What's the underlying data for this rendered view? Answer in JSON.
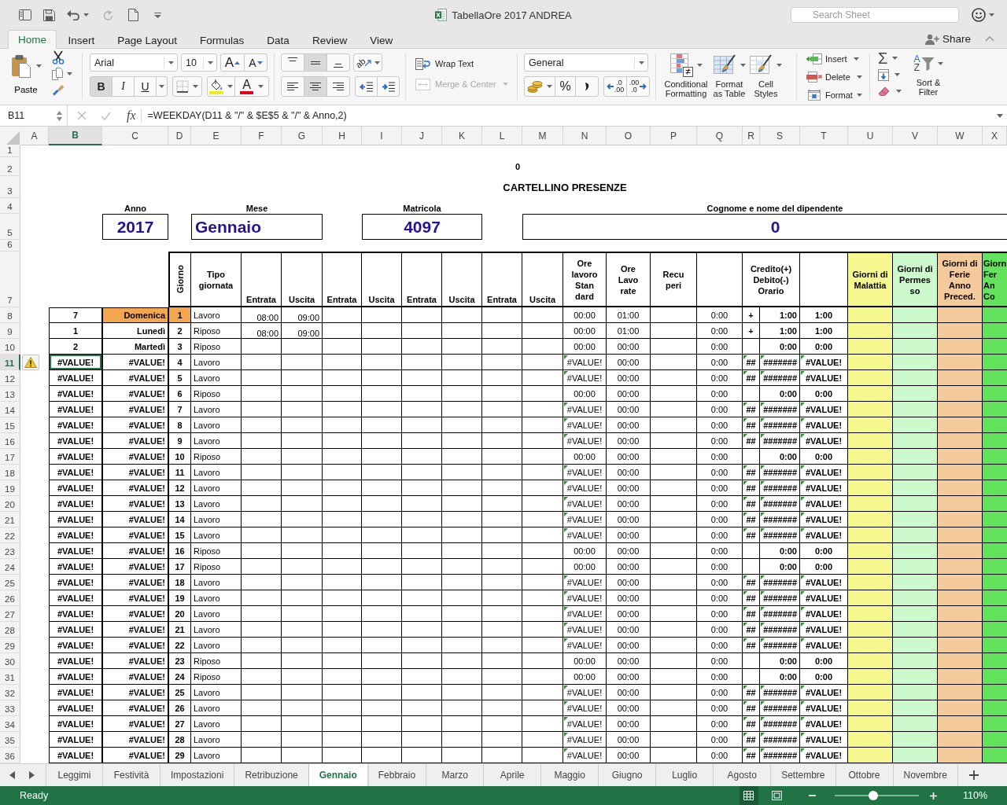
{
  "window": {
    "title": "TabellaOre 2017 ANDREA",
    "search": {
      "placeholder": "Search Sheet"
    }
  },
  "ribbon_tabs": [
    {
      "label": "Home",
      "selected": true
    },
    {
      "label": "Insert",
      "selected": false
    },
    {
      "label": "Page Layout",
      "selected": false
    },
    {
      "label": "Formulas",
      "selected": false
    },
    {
      "label": "Data",
      "selected": false
    },
    {
      "label": "Review",
      "selected": false
    },
    {
      "label": "View",
      "selected": false
    }
  ],
  "share": {
    "label": "Share"
  },
  "ribbon": {
    "paste": "Paste",
    "font_name": "Arial",
    "font_size": "10",
    "grow_font": "A",
    "shrink_font": "A",
    "font_styles": [
      {
        "label": "B",
        "selected": true
      },
      {
        "label": "I",
        "selected": false
      },
      {
        "label": "U",
        "selected": false
      }
    ],
    "font_color": "A",
    "alignment": {
      "vertical": [
        {
          "selected": false
        },
        {
          "selected": true
        },
        {
          "selected": false
        }
      ],
      "horizontal": [
        {
          "selected": false
        },
        {
          "selected": true
        },
        {
          "selected": false
        }
      ]
    },
    "orientation": "ab",
    "wrap_text": "Wrap Text",
    "merge_center": {
      "label": "Merge & Center",
      "disabled": true
    },
    "number_format": "General",
    "percent": "%",
    "increase_decimal": [
      ".0",
      ".00"
    ],
    "decrease_decimal": [
      ".00",
      ".0"
    ],
    "conditional_formatting": "Conditional Formatting",
    "format_as_table": "Format as Table",
    "cell_styles": "Cell Styles",
    "insert": "Insert",
    "delete": "Delete",
    "format": "Format",
    "autosum": "Σ",
    "sort_letters": [
      "A",
      "Z"
    ],
    "sort_filter": "Sort & Filter"
  },
  "formula_bar": {
    "cell_reference": "B11",
    "function_label": "fx",
    "formula": "=WEEKDAY(D11 & \"/\" & $E$5 & \"/\" & Anno,2)"
  },
  "sheet": {
    "columns": [
      {
        "label": "A",
        "selected": false
      },
      {
        "label": "B",
        "selected": true
      },
      {
        "label": "C",
        "selected": false
      },
      {
        "label": "D",
        "selected": false
      },
      {
        "label": "E",
        "selected": false
      },
      {
        "label": "F",
        "selected": false
      },
      {
        "label": "G",
        "selected": false
      },
      {
        "label": "H",
        "selected": false
      },
      {
        "label": "I",
        "selected": false
      },
      {
        "label": "J",
        "selected": false
      },
      {
        "label": "K",
        "selected": false
      },
      {
        "label": "L",
        "selected": false
      },
      {
        "label": "M",
        "selected": false
      },
      {
        "label": "N",
        "selected": false
      },
      {
        "label": "O",
        "selected": false
      },
      {
        "label": "P",
        "selected": false
      },
      {
        "label": "Q",
        "selected": false
      },
      {
        "label": "R",
        "selected": false
      },
      {
        "label": "S",
        "selected": false
      },
      {
        "label": "T",
        "selected": false
      },
      {
        "label": "U",
        "selected": false
      },
      {
        "label": "V",
        "selected": false
      },
      {
        "label": "W",
        "selected": false
      },
      {
        "label": "X",
        "selected": false
      }
    ],
    "row_numbers": [
      {
        "label": "1",
        "selected": false
      },
      {
        "label": "2",
        "selected": false
      },
      {
        "label": "3",
        "selected": false
      },
      {
        "label": "4",
        "selected": false
      },
      {
        "label": "5",
        "selected": false
      },
      {
        "label": "6",
        "selected": false
      },
      {
        "label": "7",
        "selected": false
      },
      {
        "label": "8",
        "selected": false
      },
      {
        "label": "9",
        "selected": false
      },
      {
        "label": "10",
        "selected": false
      },
      {
        "label": "11",
        "selected": true
      },
      {
        "label": "12",
        "selected": false
      },
      {
        "label": "13",
        "selected": false
      },
      {
        "label": "14",
        "selected": false
      },
      {
        "label": "15",
        "selected": false
      },
      {
        "label": "16",
        "selected": false
      },
      {
        "label": "17",
        "selected": false
      },
      {
        "label": "18",
        "selected": false
      },
      {
        "label": "19",
        "selected": false
      },
      {
        "label": "20",
        "selected": false
      },
      {
        "label": "21",
        "selected": false
      },
      {
        "label": "22",
        "selected": false
      },
      {
        "label": "23",
        "selected": false
      },
      {
        "label": "24",
        "selected": false
      },
      {
        "label": "25",
        "selected": false
      },
      {
        "label": "26",
        "selected": false
      },
      {
        "label": "27",
        "selected": false
      },
      {
        "label": "28",
        "selected": false
      },
      {
        "label": "29",
        "selected": false
      },
      {
        "label": "30",
        "selected": false
      },
      {
        "label": "31",
        "selected": false
      },
      {
        "label": "32",
        "selected": false
      },
      {
        "label": "33",
        "selected": false
      },
      {
        "label": "34",
        "selected": false
      },
      {
        "label": "35",
        "selected": false
      },
      {
        "label": "36",
        "selected": false
      }
    ],
    "top_value": "0",
    "title": "CARTELLINO PRESENZE",
    "fields": [
      {
        "label": "Anno",
        "value": "2017"
      },
      {
        "label": "Mese",
        "value": "Gennaio"
      },
      {
        "label": "Matricola",
        "value": "4097"
      },
      {
        "label": "Cognome e nome del dipendente",
        "value": "0"
      }
    ],
    "table_headers": [
      {
        "text": "Giorno"
      },
      {
        "text": "Tipo\ngiornata"
      },
      {
        "text": "Entrata"
      },
      {
        "text": "Uscita"
      },
      {
        "text": "Entrata"
      },
      {
        "text": "Uscita"
      },
      {
        "text": "Entrata"
      },
      {
        "text": "Uscita"
      },
      {
        "text": "Entrata"
      },
      {
        "text": "Uscita"
      },
      {
        "text": "Ore\nlavoro\nStan\ndard"
      },
      {
        "text": "Ore\nLavo\nrate"
      },
      {
        "text": "Recu\nperi"
      },
      {
        "text": "Credito(+)\nDebito(-)\nOrario"
      },
      {
        "text": "Giorni di\nMalattia",
        "color": "#f7f78f"
      },
      {
        "text": "Giorni di\nPermes\nso",
        "color": "#ccfacc"
      },
      {
        "text": "Giorni di\nFerie\nAnno\nPreced.",
        "color": "#f5ca9b"
      },
      {
        "text": "Giorn\nFer\nAn\nCo",
        "color": "#63e35c"
      }
    ],
    "rows": [
      {
        "cells": {
          "B": "7",
          "C": "Domenica",
          "D": "1",
          "E": "Lavoro",
          "F": "08:00",
          "G": "09:00",
          "N": "00:00",
          "O": "01:00",
          "Q": "0:00",
          "R": "+",
          "S": "1:00",
          "T": "1:00"
        },
        "highlighted": true,
        "error_flags": false
      },
      {
        "cells": {
          "B": "1",
          "C": "Lunedì",
          "D": "2",
          "E": "Riposo",
          "F": "08:00",
          "G": "09:00",
          "N": "00:00",
          "O": "01:00",
          "Q": "0:00",
          "R": "+",
          "S": "1:00",
          "T": "1:00"
        },
        "highlighted": false,
        "error_flags": false
      },
      {
        "cells": {
          "B": "2",
          "C": "Martedì",
          "D": "3",
          "E": "Riposo",
          "N": "00:00",
          "O": "00:00",
          "Q": "0:00",
          "S": "0:00",
          "T": "0:00"
        },
        "highlighted": false,
        "error_flags": false
      },
      {
        "cells": {
          "B": "#VALUE!",
          "C": "#VALUE!",
          "D": "4",
          "E": "Lavoro",
          "N": "#VALUE!",
          "O": "00:00",
          "Q": "0:00",
          "R": "##",
          "S": "#######",
          "T": "#VALUE!"
        },
        "highlighted": false,
        "error_flags": true
      },
      {
        "cells": {
          "B": "#VALUE!",
          "C": "#VALUE!",
          "D": "5",
          "E": "Lavoro",
          "N": "#VALUE!",
          "O": "00:00",
          "Q": "0:00",
          "R": "##",
          "S": "#######",
          "T": "#VALUE!"
        },
        "highlighted": false,
        "error_flags": true
      },
      {
        "cells": {
          "B": "#VALUE!",
          "C": "#VALUE!",
          "D": "6",
          "E": "Riposo",
          "N": "00:00",
          "O": "00:00",
          "Q": "0:00",
          "S": "0:00",
          "T": "0:00"
        },
        "highlighted": false,
        "error_flags": false
      },
      {
        "cells": {
          "B": "#VALUE!",
          "C": "#VALUE!",
          "D": "7",
          "E": "Lavoro",
          "N": "#VALUE!",
          "O": "00:00",
          "Q": "0:00",
          "R": "##",
          "S": "#######",
          "T": "#VALUE!"
        },
        "highlighted": false,
        "error_flags": true
      },
      {
        "cells": {
          "B": "#VALUE!",
          "C": "#VALUE!",
          "D": "8",
          "E": "Lavoro",
          "N": "#VALUE!",
          "O": "00:00",
          "Q": "0:00",
          "R": "##",
          "S": "#######",
          "T": "#VALUE!"
        },
        "highlighted": false,
        "error_flags": true
      },
      {
        "cells": {
          "B": "#VALUE!",
          "C": "#VALUE!",
          "D": "9",
          "E": "Lavoro",
          "N": "#VALUE!",
          "O": "00:00",
          "Q": "0:00",
          "R": "##",
          "S": "#######",
          "T": "#VALUE!"
        },
        "highlighted": false,
        "error_flags": true
      },
      {
        "cells": {
          "B": "#VALUE!",
          "C": "#VALUE!",
          "D": "10",
          "E": "Riposo",
          "N": "00:00",
          "O": "00:00",
          "Q": "0:00",
          "S": "0:00",
          "T": "0:00"
        },
        "highlighted": false,
        "error_flags": false
      },
      {
        "cells": {
          "B": "#VALUE!",
          "C": "#VALUE!",
          "D": "11",
          "E": "Lavoro",
          "N": "#VALUE!",
          "O": "00:00",
          "Q": "0:00",
          "R": "##",
          "S": "#######",
          "T": "#VALUE!"
        },
        "highlighted": false,
        "error_flags": true
      },
      {
        "cells": {
          "B": "#VALUE!",
          "C": "#VALUE!",
          "D": "12",
          "E": "Lavoro",
          "N": "#VALUE!",
          "O": "00:00",
          "Q": "0:00",
          "R": "##",
          "S": "#######",
          "T": "#VALUE!"
        },
        "highlighted": false,
        "error_flags": true
      },
      {
        "cells": {
          "B": "#VALUE!",
          "C": "#VALUE!",
          "D": "13",
          "E": "Lavoro",
          "N": "#VALUE!",
          "O": "00:00",
          "Q": "0:00",
          "R": "##",
          "S": "#######",
          "T": "#VALUE!"
        },
        "highlighted": false,
        "error_flags": true
      },
      {
        "cells": {
          "B": "#VALUE!",
          "C": "#VALUE!",
          "D": "14",
          "E": "Lavoro",
          "N": "#VALUE!",
          "O": "00:00",
          "Q": "0:00",
          "R": "##",
          "S": "#######",
          "T": "#VALUE!"
        },
        "highlighted": false,
        "error_flags": true
      },
      {
        "cells": {
          "B": "#VALUE!",
          "C": "#VALUE!",
          "D": "15",
          "E": "Lavoro",
          "N": "#VALUE!",
          "O": "00:00",
          "Q": "0:00",
          "R": "##",
          "S": "#######",
          "T": "#VALUE!"
        },
        "highlighted": false,
        "error_flags": true
      },
      {
        "cells": {
          "B": "#VALUE!",
          "C": "#VALUE!",
          "D": "16",
          "E": "Riposo",
          "N": "00:00",
          "O": "00:00",
          "Q": "0:00",
          "S": "0:00",
          "T": "0:00"
        },
        "highlighted": false,
        "error_flags": false
      },
      {
        "cells": {
          "B": "#VALUE!",
          "C": "#VALUE!",
          "D": "17",
          "E": "Riposo",
          "N": "00:00",
          "O": "00:00",
          "Q": "0:00",
          "S": "0:00",
          "T": "0:00"
        },
        "highlighted": false,
        "error_flags": false
      },
      {
        "cells": {
          "B": "#VALUE!",
          "C": "#VALUE!",
          "D": "18",
          "E": "Lavoro",
          "N": "#VALUE!",
          "O": "00:00",
          "Q": "0:00",
          "R": "##",
          "S": "#######",
          "T": "#VALUE!"
        },
        "highlighted": false,
        "error_flags": true
      },
      {
        "cells": {
          "B": "#VALUE!",
          "C": "#VALUE!",
          "D": "19",
          "E": "Lavoro",
          "N": "#VALUE!",
          "O": "00:00",
          "Q": "0:00",
          "R": "##",
          "S": "#######",
          "T": "#VALUE!"
        },
        "highlighted": false,
        "error_flags": true
      },
      {
        "cells": {
          "B": "#VALUE!",
          "C": "#VALUE!",
          "D": "20",
          "E": "Lavoro",
          "N": "#VALUE!",
          "O": "00:00",
          "Q": "0:00",
          "R": "##",
          "S": "#######",
          "T": "#VALUE!"
        },
        "highlighted": false,
        "error_flags": true
      },
      {
        "cells": {
          "B": "#VALUE!",
          "C": "#VALUE!",
          "D": "21",
          "E": "Lavoro",
          "N": "#VALUE!",
          "O": "00:00",
          "Q": "0:00",
          "R": "##",
          "S": "#######",
          "T": "#VALUE!"
        },
        "highlighted": false,
        "error_flags": true
      },
      {
        "cells": {
          "B": "#VALUE!",
          "C": "#VALUE!",
          "D": "22",
          "E": "Lavoro",
          "N": "#VALUE!",
          "O": "00:00",
          "Q": "0:00",
          "R": "##",
          "S": "#######",
          "T": "#VALUE!"
        },
        "highlighted": false,
        "error_flags": true
      },
      {
        "cells": {
          "B": "#VALUE!",
          "C": "#VALUE!",
          "D": "23",
          "E": "Riposo",
          "N": "00:00",
          "O": "00:00",
          "Q": "0:00",
          "S": "0:00",
          "T": "0:00"
        },
        "highlighted": false,
        "error_flags": false
      },
      {
        "cells": {
          "B": "#VALUE!",
          "C": "#VALUE!",
          "D": "24",
          "E": "Riposo",
          "N": "00:00",
          "O": "00:00",
          "Q": "0:00",
          "S": "0:00",
          "T": "0:00"
        },
        "highlighted": false,
        "error_flags": false
      },
      {
        "cells": {
          "B": "#VALUE!",
          "C": "#VALUE!",
          "D": "25",
          "E": "Lavoro",
          "N": "#VALUE!",
          "O": "00:00",
          "Q": "0:00",
          "R": "##",
          "S": "#######",
          "T": "#VALUE!"
        },
        "highlighted": false,
        "error_flags": true
      },
      {
        "cells": {
          "B": "#VALUE!",
          "C": "#VALUE!",
          "D": "26",
          "E": "Lavoro",
          "N": "#VALUE!",
          "O": "00:00",
          "Q": "0:00",
          "R": "##",
          "S": "#######",
          "T": "#VALUE!"
        },
        "highlighted": false,
        "error_flags": true
      },
      {
        "cells": {
          "B": "#VALUE!",
          "C": "#VALUE!",
          "D": "27",
          "E": "Lavoro",
          "N": "#VALUE!",
          "O": "00:00",
          "Q": "0:00",
          "R": "##",
          "S": "#######",
          "T": "#VALUE!"
        },
        "highlighted": false,
        "error_flags": true
      },
      {
        "cells": {
          "B": "#VALUE!",
          "C": "#VALUE!",
          "D": "28",
          "E": "Lavoro",
          "N": "#VALUE!",
          "O": "00:00",
          "Q": "0:00",
          "R": "##",
          "S": "#######",
          "T": "#VALUE!"
        },
        "highlighted": false,
        "error_flags": true
      },
      {
        "cells": {
          "B": "#VALUE!",
          "C": "#VALUE!",
          "D": "29",
          "E": "Lavoro",
          "N": "#VALUE!",
          "O": "00:00",
          "Q": "0:00",
          "R": "##",
          "S": "#######",
          "T": "#VALUE!"
        },
        "highlighted": false,
        "error_flags": true
      }
    ]
  },
  "sheet_tabs": [
    {
      "label": "Leggimi",
      "selected": false
    },
    {
      "label": "Festività",
      "selected": false
    },
    {
      "label": "Impostazioni",
      "selected": false
    },
    {
      "label": "Retribuzione",
      "selected": false
    },
    {
      "label": "Gennaio",
      "selected": true
    },
    {
      "label": "Febbraio",
      "selected": false
    },
    {
      "label": "Marzo",
      "selected": false
    },
    {
      "label": "Aprile",
      "selected": false
    },
    {
      "label": "Maggio",
      "selected": false
    },
    {
      "label": "Giugno",
      "selected": false
    },
    {
      "label": "Luglio",
      "selected": false
    },
    {
      "label": "Agosto",
      "selected": false
    },
    {
      "label": "Settembre",
      "selected": false
    },
    {
      "label": "Ottobre",
      "selected": false
    },
    {
      "label": "Novembre",
      "selected": false
    }
  ],
  "status_bar": {
    "text": "Ready",
    "views": [
      {
        "selected": true
      },
      {
        "selected": false
      }
    ],
    "level": 0.46,
    "zoom": "110%"
  }
}
